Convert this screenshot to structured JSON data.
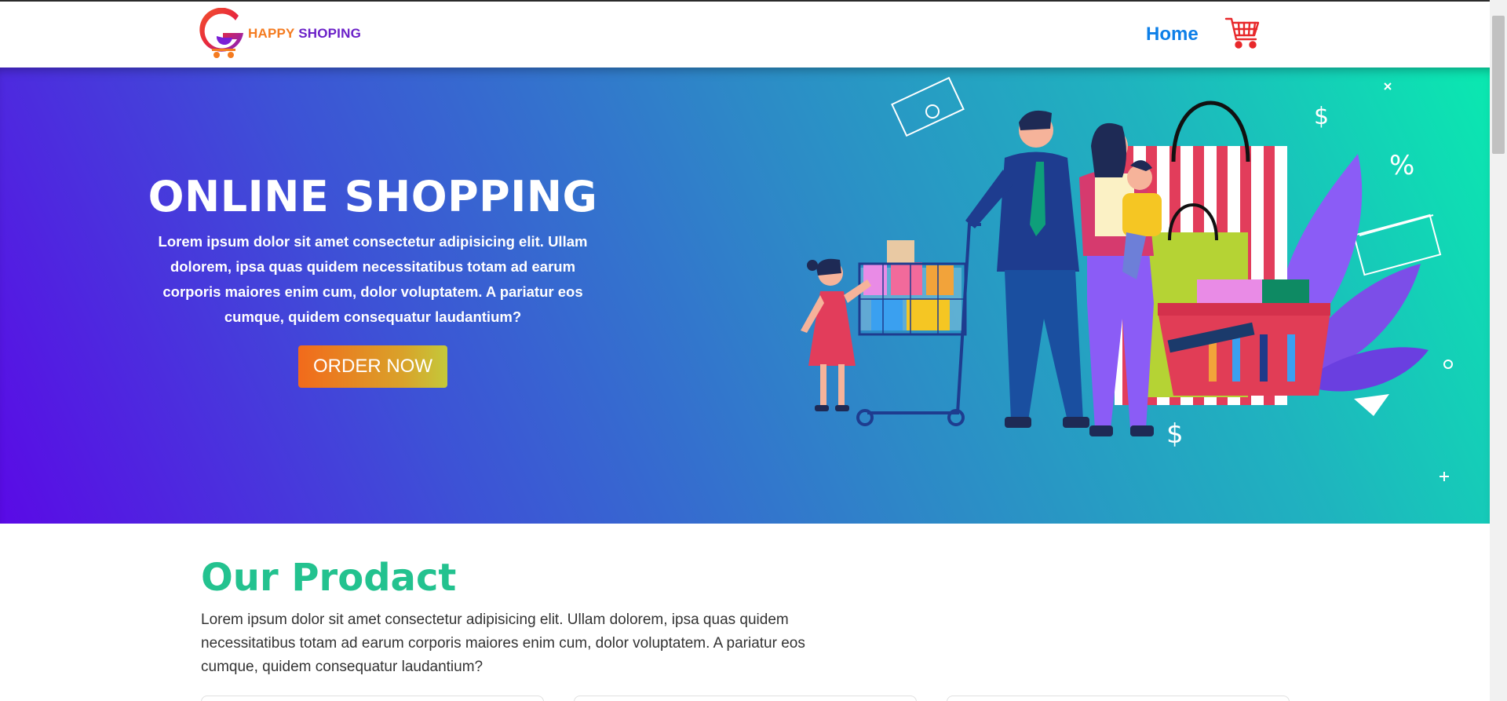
{
  "nav": {
    "brand": {
      "word1": "HAPPY",
      "word2": "SHOPING"
    },
    "home_label": "Home",
    "cart_icon": "shopping-cart-icon"
  },
  "hero": {
    "title": "ONLINE SHOPPING",
    "text": "Lorem ipsum dolor sit amet consectetur adipisicing elit. Ullam dolorem, ipsa quas quidem necessitatibus totam ad earum corporis maiores enim cum, dolor voluptatem. A pariatur eos cumque, quidem consequatur laudantium?",
    "button_label": "ORDER NOW",
    "illustration": "family-shopping-illustration"
  },
  "products": {
    "title": "Our Prodact",
    "text": "Lorem ipsum dolor sit amet consectetur adipisicing elit. Ullam dolorem, ipsa quas quidem necessitatibus totam ad earum corporis maiores enim cum, dolor voluptatem. A pariatur eos cumque, quidem consequatur laudantium?",
    "cards": [
      {},
      {},
      {}
    ]
  },
  "colors": {
    "brand_orange": "#f47b20",
    "brand_purple": "#6b21c8",
    "nav_link": "#0d7fe8",
    "hero_gradient_start": "#5a0ae6",
    "hero_gradient_end": "#0ae9b0",
    "heading_green": "#23c28f",
    "cart_red": "#e8282b"
  }
}
